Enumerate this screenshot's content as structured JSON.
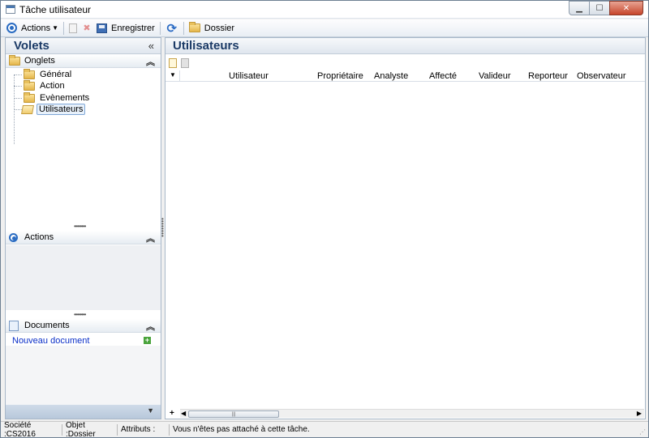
{
  "window": {
    "title": "Tâche utilisateur",
    "buttons": {
      "minimize": "▁",
      "maximize": "☐",
      "close": "✕"
    }
  },
  "toolbar": {
    "actions_label": "Actions",
    "save_label": "Enregistrer",
    "folder_label": "Dossier"
  },
  "left_panel": {
    "title": "Volets",
    "collapse_glyph": "«",
    "onglets": {
      "label": "Onglets",
      "items": [
        {
          "label": "Général"
        },
        {
          "label": "Action"
        },
        {
          "label": "Evènements"
        },
        {
          "label": "Utilisateurs",
          "selected": true
        }
      ]
    },
    "actions": {
      "label": "Actions"
    },
    "documents": {
      "label": "Documents",
      "new_document": "Nouveau document"
    }
  },
  "main": {
    "title": "Utilisateurs",
    "columns": [
      "Utilisateur",
      "Propriétaire",
      "Analyste",
      "Affecté",
      "Valideur",
      "Reporteur",
      "Observateur"
    ],
    "rows": []
  },
  "status": {
    "company": "Société :CS2016",
    "object": "Objet :Dossier",
    "attributes": "Attributs :",
    "message": "Vous n'êtes pas attaché à cette tâche."
  },
  "colors": {
    "accent": "#2a6cc2",
    "header_text": "#1b3a66",
    "link": "#0a2fc8"
  }
}
